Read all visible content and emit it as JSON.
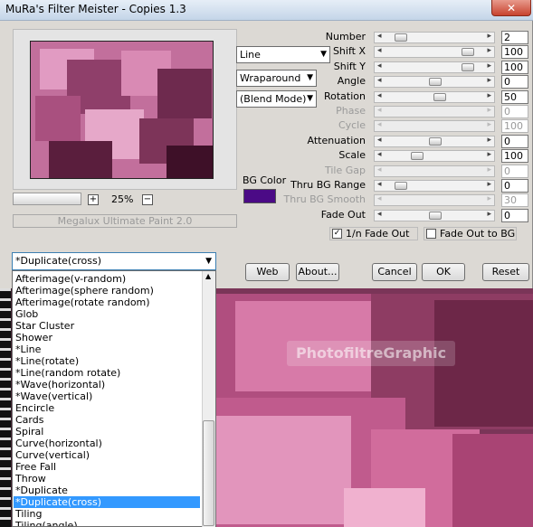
{
  "window": {
    "title": "MuRa's Filter Meister - Copies 1.3",
    "close_label": "✕"
  },
  "zoom": {
    "plus": "+",
    "minus": "−",
    "value": "25%"
  },
  "paint_label": "Megalux Ultimate Paint 2.0",
  "combos": {
    "shape": "Line",
    "edge": "Wraparound",
    "blend": "(Blend Mode)"
  },
  "bg_color": {
    "label": "BG Color",
    "swatch": "#4b0a86"
  },
  "params": [
    {
      "label": "Number",
      "value": "2",
      "enabled": true,
      "thumb": 0.12
    },
    {
      "label": "Shift X",
      "value": "100",
      "enabled": true,
      "thumb": 0.86
    },
    {
      "label": "Shift Y",
      "value": "100",
      "enabled": true,
      "thumb": 0.86
    },
    {
      "label": "Angle",
      "value": "0",
      "enabled": true,
      "thumb": 0.5
    },
    {
      "label": "Rotation",
      "value": "50",
      "enabled": true,
      "thumb": 0.55
    },
    {
      "label": "Phase",
      "value": "0",
      "enabled": false,
      "thumb": null
    },
    {
      "label": "Cycle",
      "value": "100",
      "enabled": false,
      "thumb": null
    },
    {
      "label": "Attenuation",
      "value": "0",
      "enabled": true,
      "thumb": 0.5
    },
    {
      "label": "Scale",
      "value": "100",
      "enabled": true,
      "thumb": 0.3
    },
    {
      "label": "Tile Gap",
      "value": "0",
      "enabled": false,
      "thumb": null
    },
    {
      "label": "Thru BG Range",
      "value": "0",
      "enabled": true,
      "thumb": 0.12
    },
    {
      "label": "Thru BG Smooth",
      "value": "30",
      "enabled": false,
      "thumb": null
    },
    {
      "label": "Fade Out",
      "value": "0",
      "enabled": true,
      "thumb": 0.5
    }
  ],
  "checks": {
    "fade_1n": {
      "label": "1/n Fade Out",
      "checked": true,
      "mark": "✓"
    },
    "fade_bg": {
      "label": "Fade Out to BG",
      "checked": false
    }
  },
  "buttons": {
    "web": "Web",
    "about": "About...",
    "cancel": "Cancel",
    "ok": "OK",
    "reset": "Reset"
  },
  "dropdown": {
    "selected": "*Duplicate(cross)",
    "arrow": "▼",
    "items": [
      "Afterimage(v-random)",
      "Afterimage(sphere random)",
      "Afterimage(rotate random)",
      "Glob",
      "Star Cluster",
      "Shower",
      "*Line",
      "*Line(rotate)",
      "*Line(random rotate)",
      "*Wave(horizontal)",
      "*Wave(vertical)",
      "Encircle",
      "Cards",
      "Spiral",
      "Curve(horizontal)",
      "Curve(vertical)",
      "Free Fall",
      "Throw",
      "*Duplicate",
      "*Duplicate(cross)",
      "Tiling",
      "Tiling(angle)"
    ],
    "highlighted_index": 19
  },
  "watermark": "PhotofiltreGraphic"
}
